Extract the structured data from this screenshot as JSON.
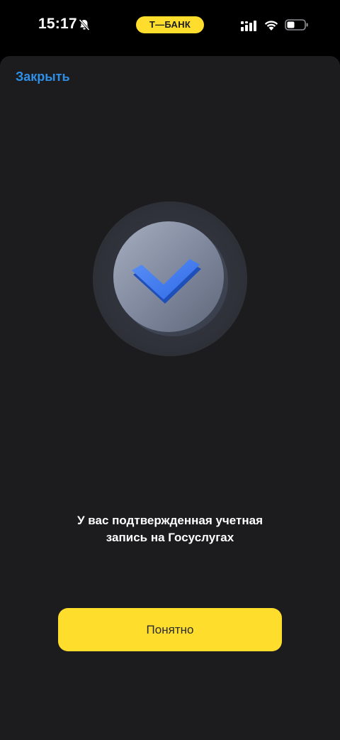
{
  "status_bar": {
    "time": "15:17",
    "brand": "Т—БАНК",
    "brand_color": "#ffdd2d",
    "icons": [
      "bell-slash-icon",
      "cellular-signal-icon",
      "wifi-icon",
      "battery-icon"
    ]
  },
  "header": {
    "close_label": "Закрыть",
    "link_color": "#2f8fe6"
  },
  "hero": {
    "icon": "checkmark-badge-icon",
    "accent": "#3d7bf0"
  },
  "message": {
    "line1": "У вас подтвержденная учетная",
    "line2": "запись на Госуслугах"
  },
  "actions": {
    "primary_label": "Понятно",
    "primary_color": "#ffdd2d"
  }
}
